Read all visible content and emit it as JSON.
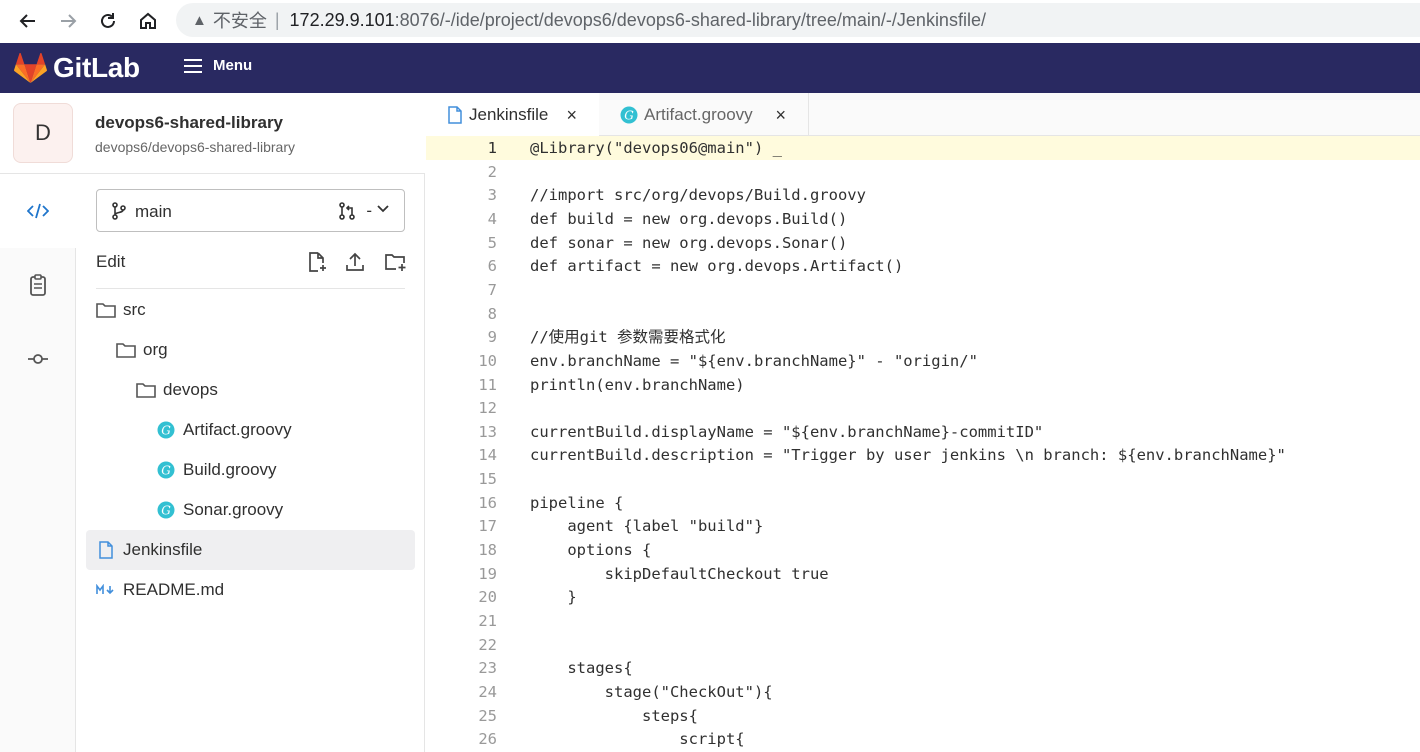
{
  "browser": {
    "warning": "▲",
    "insecure": "不安全",
    "separator": "|",
    "host": "172.29.9.101",
    "path": ":8076/-/ide/project/devops6/devops6-shared-library/tree/main/-/Jenkinsfile/"
  },
  "header": {
    "logo_text": "GitLab",
    "menu_label": "Menu"
  },
  "project": {
    "avatar_letter": "D",
    "name": "devops6-shared-library",
    "path": "devops6/devops6-shared-library"
  },
  "branch": {
    "name": "main",
    "mr": "-"
  },
  "tree": {
    "edit_label": "Edit",
    "items": [
      {
        "label": "src",
        "type": "folder"
      },
      {
        "label": "org",
        "type": "folder"
      },
      {
        "label": "devops",
        "type": "folder"
      },
      {
        "label": "Artifact.groovy",
        "type": "groovy"
      },
      {
        "label": "Build.groovy",
        "type": "groovy"
      },
      {
        "label": "Sonar.groovy",
        "type": "groovy"
      },
      {
        "label": "Jenkinsfile",
        "type": "file"
      },
      {
        "label": "README.md",
        "type": "markdown"
      }
    ]
  },
  "tabs": [
    {
      "label": "Jenkinsfile",
      "close": "×"
    },
    {
      "label": "Artifact.groovy",
      "close": "×"
    }
  ],
  "editor": {
    "lines": [
      {
        "n": "1",
        "code": "@Library(\"devops06@main\") _"
      },
      {
        "n": "2",
        "code": ""
      },
      {
        "n": "3",
        "code": "//import src/org/devops/Build.groovy"
      },
      {
        "n": "4",
        "code": "def build = new org.devops.Build()"
      },
      {
        "n": "5",
        "code": "def sonar = new org.devops.Sonar()"
      },
      {
        "n": "6",
        "code": "def artifact = new org.devops.Artifact()"
      },
      {
        "n": "7",
        "code": ""
      },
      {
        "n": "8",
        "code": ""
      },
      {
        "n": "9",
        "code": "//使用git 参数需要格式化"
      },
      {
        "n": "10",
        "code": "env.branchName = \"${env.branchName}\" - \"origin/\""
      },
      {
        "n": "11",
        "code": "println(env.branchName)"
      },
      {
        "n": "12",
        "code": ""
      },
      {
        "n": "13",
        "code": "currentBuild.displayName = \"${env.branchName}-commitID\""
      },
      {
        "n": "14",
        "code": "currentBuild.description = \"Trigger by user jenkins \\n branch: ${env.branchName}\""
      },
      {
        "n": "15",
        "code": ""
      },
      {
        "n": "16",
        "code": "pipeline {"
      },
      {
        "n": "17",
        "code": "    agent {label \"build\"}"
      },
      {
        "n": "18",
        "code": "    options {"
      },
      {
        "n": "19",
        "code": "        skipDefaultCheckout true"
      },
      {
        "n": "20",
        "code": "    }"
      },
      {
        "n": "21",
        "code": ""
      },
      {
        "n": "22",
        "code": ""
      },
      {
        "n": "23",
        "code": "    stages{"
      },
      {
        "n": "24",
        "code": "        stage(\"CheckOut\"){"
      },
      {
        "n": "25",
        "code": "            steps{"
      },
      {
        "n": "26",
        "code": "                script{"
      }
    ]
  }
}
